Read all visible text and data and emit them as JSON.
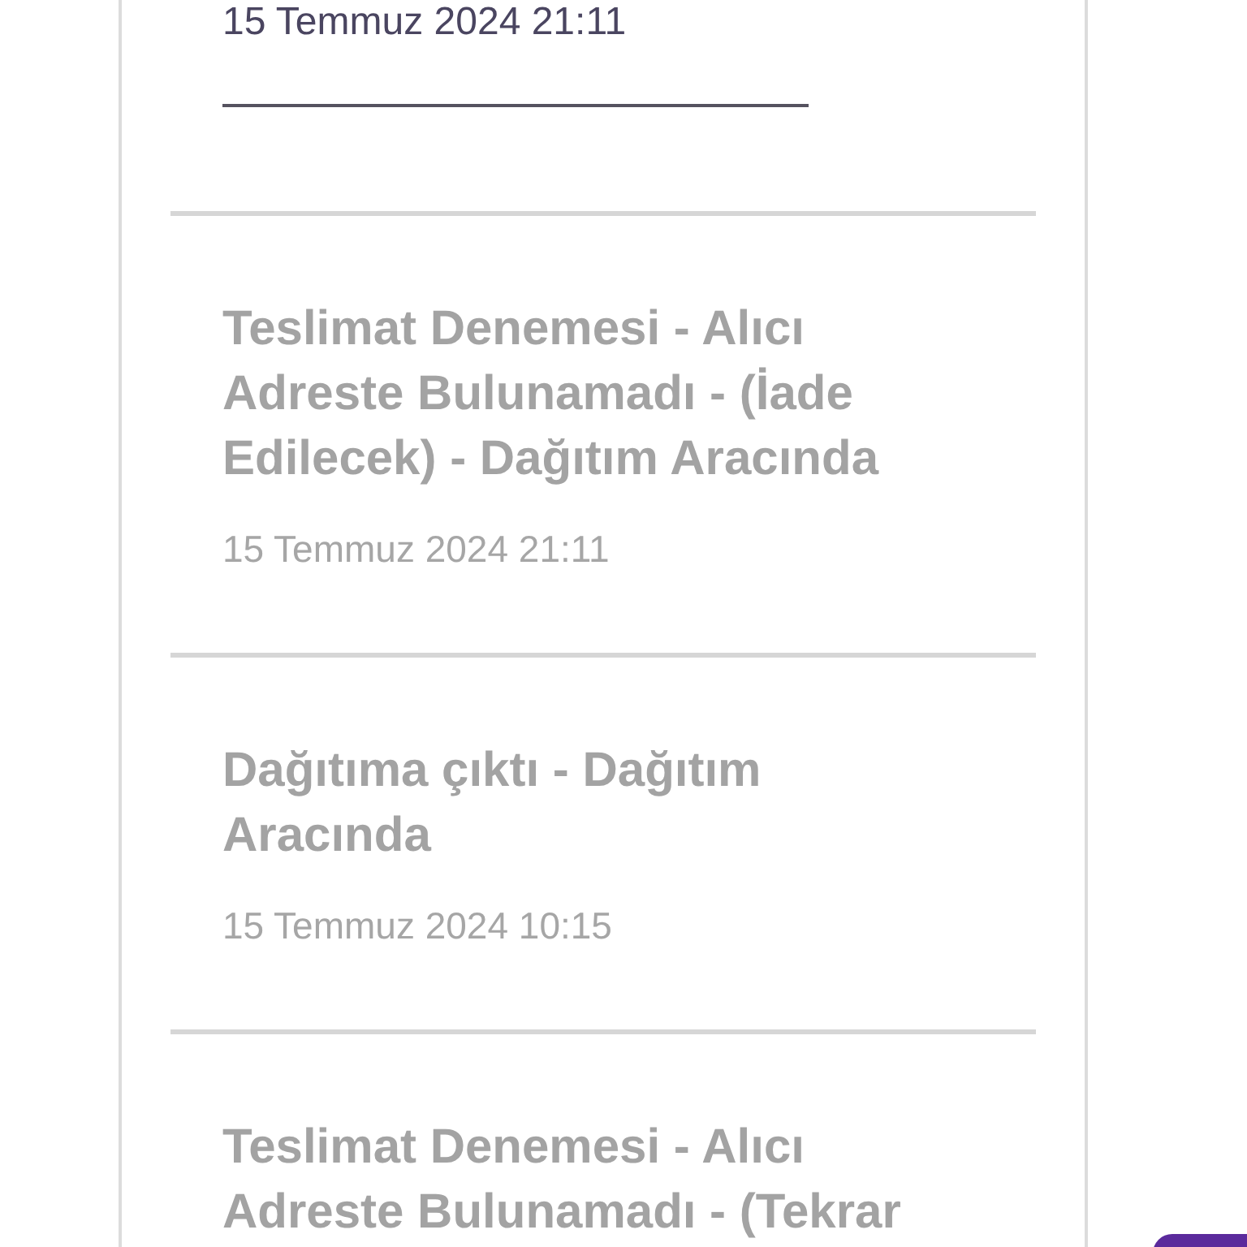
{
  "current": {
    "date": "15 Temmuz 2024 21:11"
  },
  "events": [
    {
      "title": "Teslimat Denemesi - Alıcı Adreste Bulunamadı - (İade Edilecek) - Dağıtım Aracında",
      "date": "15 Temmuz 2024 21:11"
    },
    {
      "title": "Dağıtıma çıktı - Dağıtım Aracında",
      "date": "15 Temmuz 2024 10:15"
    },
    {
      "title": "Teslimat Denemesi - Alıcı Adreste Bulunamadı - (Tekrar"
    }
  ]
}
